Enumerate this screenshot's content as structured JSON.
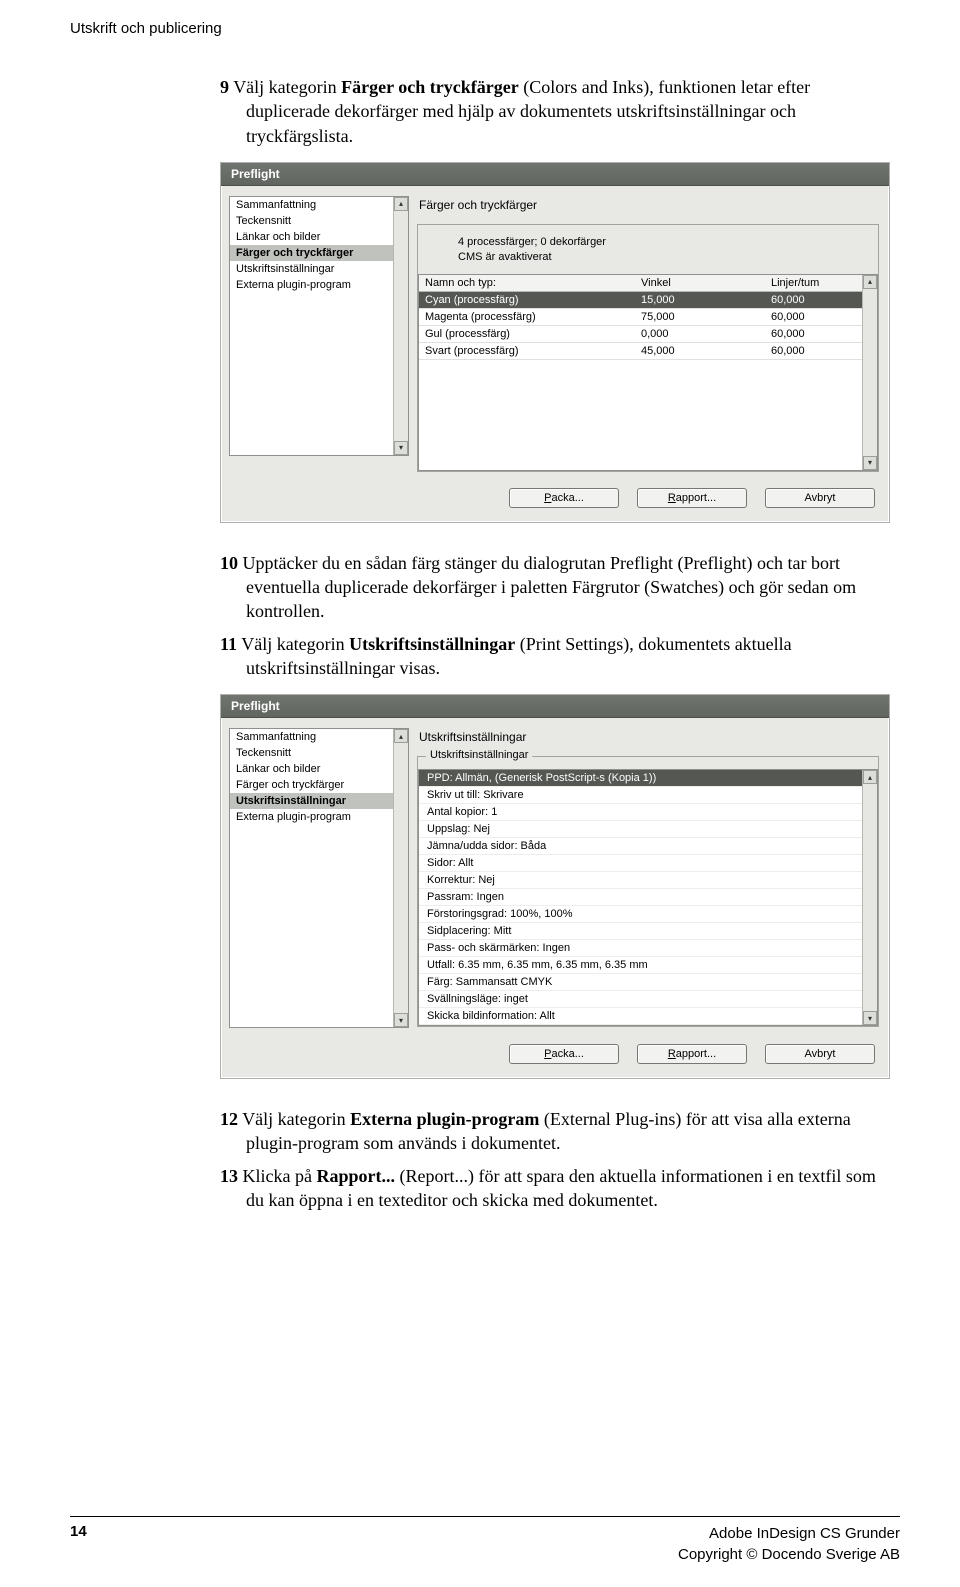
{
  "header": "Utskrift och publicering",
  "p9": {
    "num": "9",
    "pre": "Välj kategorin ",
    "bold": "Färger och tryckfärger",
    "post": " (Colors and Inks), funktionen letar efter duplicerade dekorfärger med hjälp av dokumentets utskriftsinställningar och tryckfärgslista."
  },
  "dialog1": {
    "title": "Preflight",
    "sidebar": [
      "Sammanfattning",
      "Teckensnitt",
      "Länkar och bilder",
      "Färger och tryckfärger",
      "Utskriftsinställningar",
      "Externa plugin-program"
    ],
    "selected_index": 3,
    "panel_title": "Färger och tryckfärger",
    "info1": "4 processfärger; 0 dekorfärger",
    "info2": "CMS är avaktiverat",
    "cols": {
      "name": "Namn och typ:",
      "angle": "Vinkel",
      "lpi": "Linjer/tum"
    },
    "rows": [
      {
        "name": "Cyan (processfärg)",
        "angle": "15,000",
        "lpi": "60,000",
        "selected": true
      },
      {
        "name": "Magenta (processfärg)",
        "angle": "75,000",
        "lpi": "60,000"
      },
      {
        "name": "Gul (processfärg)",
        "angle": "0,000",
        "lpi": "60,000"
      },
      {
        "name": "Svart (processfärg)",
        "angle": "45,000",
        "lpi": "60,000"
      }
    ],
    "btn_packa": "Packa...",
    "btn_rapport": "Rapport...",
    "btn_avbryt": "Avbryt"
  },
  "p10": {
    "num": "10",
    "text": "Upptäcker du en sådan färg stänger du dialogrutan Preflight (Preflight) och tar bort eventuella duplicerade dekorfärger i paletten Färgrutor (Swatches) och gör sedan om kontrollen."
  },
  "p11": {
    "num": "11",
    "pre": "Välj kategorin ",
    "bold": "Utskriftsinställningar",
    "post": " (Print Settings), dokumentets aktuella utskriftsinställningar visas."
  },
  "dialog2": {
    "title": "Preflight",
    "sidebar": [
      "Sammanfattning",
      "Teckensnitt",
      "Länkar och bilder",
      "Färger och tryckfärger",
      "Utskriftsinställningar",
      "Externa plugin-program"
    ],
    "selected_index": 4,
    "panel_title": "Utskriftsinställningar",
    "group_label": "Utskriftsinställningar",
    "rows": [
      "PPD: Allmän, (Generisk PostScript-s (Kopia 1))",
      "Skriv ut till: Skrivare",
      "Antal kopior: 1",
      "Uppslag: Nej",
      "Jämna/udda sidor: Båda",
      "Sidor: Allt",
      "Korrektur: Nej",
      "Passram: Ingen",
      "Förstoringsgrad: 100%, 100%",
      "Sidplacering: Mitt",
      "Pass- och skärmärken: Ingen",
      "Utfall: 6.35 mm, 6.35 mm, 6.35 mm, 6.35 mm",
      "Färg: Sammansatt CMYK",
      "Svällningsläge: inget",
      "Skicka bildinformation: Allt"
    ],
    "btn_packa": "Packa...",
    "btn_rapport": "Rapport...",
    "btn_avbryt": "Avbryt"
  },
  "p12": {
    "num": "12",
    "pre": "Välj kategorin ",
    "bold": "Externa plugin-program",
    "post": " (External Plug-ins) för att visa alla externa plugin-program som används i dokumentet."
  },
  "p13": {
    "num": "13",
    "pre": "Klicka på ",
    "bold": "Rapport...",
    "post": " (Report...) för att spara den aktuella informationen i en textfil som du kan öppna i en texteditor och skicka med dokumentet."
  },
  "footer": {
    "page": "14",
    "line1": "Adobe InDesign CS Grunder",
    "line2": "Copyright © Docendo Sverige AB"
  }
}
